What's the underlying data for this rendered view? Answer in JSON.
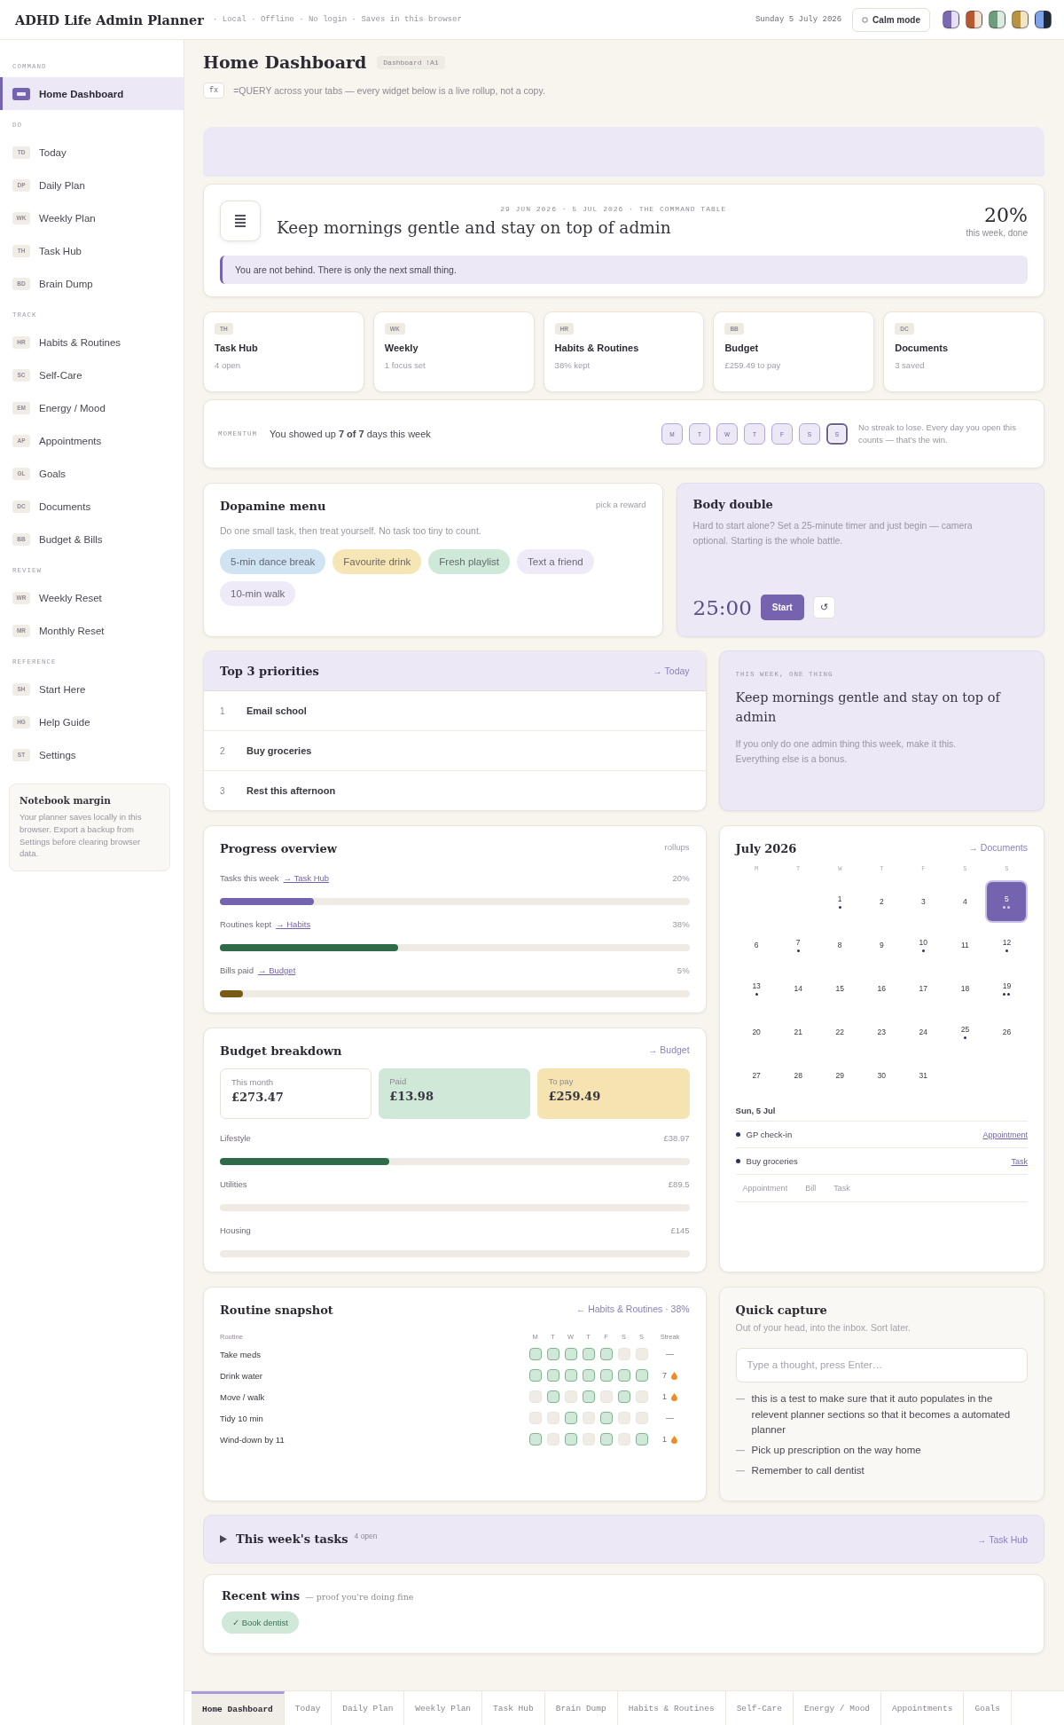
{
  "header": {
    "title": "ADHD Life Admin Planner",
    "tagline": "· Local · Offline · No login · Saves in this browser",
    "date": "Sunday 5 July 2026",
    "calm_button": "Calm mode",
    "themes": [
      {
        "colors": [
          {
            "color": "#7a68b3"
          },
          {
            "color": "#e6e0f5"
          }
        ]
      },
      {
        "colors": [
          {
            "color": "#b8582f"
          },
          {
            "color": "#f2e2d2"
          }
        ]
      },
      {
        "colors": [
          {
            "color": "#6f9c7c"
          },
          {
            "color": "#dcebe0"
          }
        ]
      },
      {
        "colors": [
          {
            "color": "#b89442"
          },
          {
            "color": "#f2e5c6"
          }
        ]
      },
      {
        "colors": [
          {
            "color": "#7ea3e8"
          },
          {
            "color": "#1d2a33"
          }
        ]
      }
    ]
  },
  "sidebar": {
    "sections": [
      {
        "label": "COMMAND",
        "items": [
          {
            "label": "Home Dashboard",
            "selected": true
          }
        ]
      },
      {
        "label": "DO",
        "items": [
          {
            "abbr": "TD",
            "label": "Today",
            "selected": false
          },
          {
            "abbr": "DP",
            "label": "Daily Plan",
            "selected": false
          },
          {
            "abbr": "WK",
            "label": "Weekly Plan",
            "selected": false
          },
          {
            "abbr": "TH",
            "label": "Task Hub",
            "selected": false
          },
          {
            "abbr": "BD",
            "label": "Brain Dump",
            "selected": false
          }
        ]
      },
      {
        "label": "TRACK",
        "items": [
          {
            "abbr": "HR",
            "label": "Habits & Routines",
            "selected": false
          },
          {
            "abbr": "SC",
            "label": "Self-Care",
            "selected": false
          },
          {
            "abbr": "EM",
            "label": "Energy / Mood",
            "selected": false
          },
          {
            "abbr": "AP",
            "label": "Appointments",
            "selected": false
          },
          {
            "abbr": "GL",
            "label": "Goals",
            "selected": false
          },
          {
            "abbr": "DC",
            "label": "Documents",
            "selected": false
          },
          {
            "abbr": "BB",
            "label": "Budget & Bills",
            "selected": false
          }
        ]
      },
      {
        "label": "REVIEW",
        "items": [
          {
            "abbr": "WR",
            "label": "Weekly Reset",
            "selected": false
          },
          {
            "abbr": "MR",
            "label": "Monthly Reset",
            "selected": false
          }
        ]
      },
      {
        "label": "REFERENCE",
        "items": [
          {
            "abbr": "SH",
            "label": "Start Here",
            "selected": false
          },
          {
            "abbr": "HG",
            "label": "Help Guide",
            "selected": false
          },
          {
            "abbr": "ST",
            "label": "Settings",
            "selected": false
          }
        ]
      }
    ],
    "note": {
      "title": "Notebook margin",
      "text": "Your planner saves locally in this browser. Export a backup from Settings before clearing browser data."
    }
  },
  "page": {
    "title": "Home Dashboard",
    "badge": "Dashboard !A1",
    "formula_chip": "fx",
    "formula": "=QUERY across your tabs — every widget below is a live rollup, not a copy."
  },
  "hero": {
    "range": "29 JUN 2026 · 5 JUL 2026 · THE COMMAND TABLE",
    "headline": "Keep mornings gentle and stay on top of admin",
    "percent": "20%",
    "percent_label": "this week, done",
    "quote": "You are not behind. There is only the next small thing."
  },
  "stat_cards": [
    {
      "abbr": "TH",
      "title": "Task Hub",
      "detail": "4 open"
    },
    {
      "abbr": "WK",
      "title": "Weekly",
      "detail": "1 focus set"
    },
    {
      "abbr": "HR",
      "title": "Habits & Routines",
      "detail": "38% kept"
    },
    {
      "abbr": "BB",
      "title": "Budget",
      "detail": "£259.49 to pay"
    },
    {
      "abbr": "DC",
      "title": "Documents",
      "detail": "3 saved"
    }
  ],
  "momentum": {
    "label": "MOMENTUM",
    "text": "You showed up **7 of 7** days this week",
    "days": [
      {
        "label": "M",
        "done": true,
        "today": false
      },
      {
        "label": "T",
        "done": true,
        "today": false
      },
      {
        "label": "W",
        "done": true,
        "today": false
      },
      {
        "label": "T",
        "done": true,
        "today": false
      },
      {
        "label": "F",
        "done": true,
        "today": false
      },
      {
        "label": "S",
        "done": true,
        "today": false
      },
      {
        "label": "S",
        "done": true,
        "today": true
      }
    ],
    "note": "No streak to lose. Every day you open this counts — that's the win."
  },
  "dopamine": {
    "title": "Dopamine menu",
    "hint": "pick a reward",
    "text": "Do one small task, then treat yourself. No task too tiny to count.",
    "rewards": [
      {
        "label": "5-min dance break",
        "color": "#cfe3f2"
      },
      {
        "label": "Favourite drink",
        "color": "#f6e6b6"
      },
      {
        "label": "Fresh playlist",
        "color": "#cfe9d8"
      },
      {
        "label": "Text a friend",
        "color": "#eeeaf8"
      },
      {
        "label": "10-min walk",
        "color": "#eeeaf8"
      }
    ]
  },
  "body_double": {
    "title": "Body double",
    "text": "Hard to start alone? Set a 25-minute timer and just begin — camera optional. Starting is the whole battle.",
    "timer": "25:00",
    "start": "Start",
    "reset": "↺"
  },
  "priorities": {
    "title": "Top 3 priorities",
    "link": "→ Today",
    "items": [
      {
        "number": "1",
        "label": "Email school"
      },
      {
        "number": "2",
        "label": "Buy groceries"
      },
      {
        "number": "3",
        "label": "Rest this afternoon"
      }
    ]
  },
  "one_thing": {
    "label": "THIS WEEK, ONE THING",
    "headline": "Keep mornings gentle and stay on top of admin",
    "text": "If you only do one admin thing this week, make it this. Everything else is a bonus."
  },
  "progress": {
    "title": "Progress overview",
    "hint": "rollups",
    "rows": [
      {
        "label": "Tasks this week",
        "link": "→ Task Hub",
        "value": "20%",
        "level": 0.2,
        "color": "#7563b0"
      },
      {
        "label": "Routines kept",
        "link": "→ Habits",
        "value": "38%",
        "level": 0.38,
        "color": "#2f6b48"
      },
      {
        "label": "Bills paid",
        "link": "→ Budget",
        "value": "5%",
        "level": 0.05,
        "color": "#7a5a17"
      }
    ]
  },
  "calendar": {
    "title": "July 2026",
    "link": "→ Documents",
    "weekdays": [
      "M",
      "T",
      "W",
      "T",
      "F",
      "S",
      "S"
    ],
    "weeks": [
      {
        "kind": "first_week",
        "days": [
          {
            "day": "1",
            "selected": false,
            "dots": [
              {
                "kind": "event"
              }
            ]
          },
          {
            "day": "2",
            "selected": false
          },
          {
            "day": "3",
            "selected": false
          },
          {
            "day": "4",
            "selected": false
          },
          {
            "day": "5",
            "selected": true,
            "dots": [
              {
                "kind": "event"
              },
              {
                "kind": "event"
              }
            ]
          }
        ]
      },
      {
        "kind": "week",
        "days": [
          {
            "day": "6",
            "selected": false
          },
          {
            "day": "7",
            "selected": false,
            "dots": [
              {
                "kind": "event"
              }
            ]
          },
          {
            "day": "8",
            "selected": false
          },
          {
            "day": "9",
            "selected": false
          },
          {
            "day": "10",
            "selected": false,
            "dots": [
              {
                "kind": "event"
              }
            ]
          },
          {
            "day": "11",
            "selected": false
          },
          {
            "day": "12",
            "selected": false,
            "dots": [
              {
                "kind": "event"
              }
            ]
          }
        ]
      },
      {
        "kind": "week",
        "days": [
          {
            "day": "13",
            "selected": false,
            "dots": [
              {
                "kind": "event"
              }
            ]
          },
          {
            "day": "14",
            "selected": false
          },
          {
            "day": "15",
            "selected": false
          },
          {
            "day": "16",
            "selected": false
          },
          {
            "day": "17",
            "selected": false
          },
          {
            "day": "18",
            "selected": false
          },
          {
            "day": "19",
            "selected": false,
            "dots": [
              {
                "kind": "event"
              },
              {
                "kind": "event"
              }
            ]
          }
        ]
      },
      {
        "kind": "week",
        "days": [
          {
            "day": "20",
            "selected": false
          },
          {
            "day": "21",
            "selected": false
          },
          {
            "day": "22",
            "selected": false
          },
          {
            "day": "23",
            "selected": false
          },
          {
            "day": "24",
            "selected": false
          },
          {
            "day": "25",
            "selected": false,
            "dots": [
              {
                "kind": "event"
              }
            ]
          },
          {
            "day": "26",
            "selected": false
          }
        ]
      },
      {
        "kind": "week",
        "days": [
          {
            "day": "27",
            "selected": false
          },
          {
            "day": "28",
            "selected": false
          },
          {
            "day": "29",
            "selected": false
          },
          {
            "day": "30",
            "selected": false
          },
          {
            "day": "31",
            "selected": false
          }
        ]
      }
    ],
    "selected_label": "Sun, 5 Jul",
    "events": [
      {
        "title": "GP check-in",
        "link": "Appointment"
      },
      {
        "title": "Buy groceries",
        "link": "Task"
      }
    ],
    "legend": [
      "Appointment",
      "Bill",
      "Task"
    ]
  },
  "budget": {
    "title": "Budget breakdown",
    "link": "→ Budget",
    "summary": [
      {
        "kind": "total",
        "label": "This month",
        "value": "£273.47"
      },
      {
        "kind": "paid",
        "label": "Paid",
        "value": "£13.98"
      },
      {
        "kind": "due",
        "label": "To pay",
        "value": "£259.49"
      }
    ],
    "categories": [
      {
        "label": "Lifestyle",
        "amount": "£38.97",
        "level": 0.36
      },
      {
        "label": "Utilities",
        "amount": "£89.5",
        "level": 0
      },
      {
        "label": "Housing",
        "amount": "£145",
        "level": 0
      }
    ]
  },
  "routines": {
    "title": "Routine snapshot",
    "link": "← Habits & Routines · 38%",
    "column_label": "Routine",
    "weekdays": [
      "M",
      "T",
      "W",
      "T",
      "F",
      "S",
      "S"
    ],
    "streak_label": "Streak",
    "rows": [
      {
        "name": "Take meds",
        "days": [
          {
            "done": true
          },
          {
            "done": true
          },
          {
            "done": true
          },
          {
            "done": true
          },
          {
            "done": true
          },
          {
            "done": false
          },
          {
            "done": false
          }
        ],
        "streak": "—",
        "flame": false
      },
      {
        "name": "Drink water",
        "days": [
          {
            "done": true
          },
          {
            "done": true
          },
          {
            "done": true
          },
          {
            "done": true
          },
          {
            "done": true
          },
          {
            "done": true
          },
          {
            "done": true
          }
        ],
        "streak": "7",
        "flame": true
      },
      {
        "name": "Move / walk",
        "days": [
          {
            "done": false
          },
          {
            "done": true
          },
          {
            "done": false
          },
          {
            "done": true
          },
          {
            "done": false
          },
          {
            "done": true
          },
          {
            "done": false
          }
        ],
        "streak": "1",
        "flame": true
      },
      {
        "name": "Tidy 10 min",
        "days": [
          {
            "done": false
          },
          {
            "done": false
          },
          {
            "done": true
          },
          {
            "done": false
          },
          {
            "done": true
          },
          {
            "done": false
          },
          {
            "done": false
          }
        ],
        "streak": "—",
        "flame": false
      },
      {
        "name": "Wind-down by 11",
        "days": [
          {
            "done": true
          },
          {
            "done": false
          },
          {
            "done": true
          },
          {
            "done": false
          },
          {
            "done": true
          },
          {
            "done": false
          },
          {
            "done": true
          }
        ],
        "streak": "1",
        "flame": true
      }
    ]
  },
  "quick_capture": {
    "title": "Quick capture",
    "text": "Out of your head, into the inbox. Sort later.",
    "placeholder": "Type a thought, press Enter…",
    "items": [
      "this is a test to make sure that it auto populates in the relevent planner sections so that it becomes a automated planner",
      "Pick up prescription on the way home",
      "Remember to call dentist"
    ]
  },
  "weekly_tasks": {
    "title": "This week's tasks",
    "count": "4 open",
    "link": "→ Task Hub",
    "expanded": false
  },
  "recent_wins": {
    "title": "Recent wins",
    "subtitle": "— proof you're doing fine",
    "wins": [
      "✓ Book dentist"
    ]
  },
  "sheet_tabs": [
    {
      "label": "Home Dashboard",
      "selected": true
    },
    {
      "label": "Today",
      "selected": false
    },
    {
      "label": "Daily Plan",
      "selected": false
    },
    {
      "label": "Weekly Plan",
      "selected": false
    },
    {
      "label": "Task Hub",
      "selected": false
    },
    {
      "label": "Brain Dump",
      "selected": false
    },
    {
      "label": "Habits & Routines",
      "selected": false
    },
    {
      "label": "Self-Care",
      "selected": false
    },
    {
      "label": "Energy / Mood",
      "selected": false
    },
    {
      "label": "Appointments",
      "selected": false
    },
    {
      "label": "Goals",
      "selected": false
    }
  ]
}
